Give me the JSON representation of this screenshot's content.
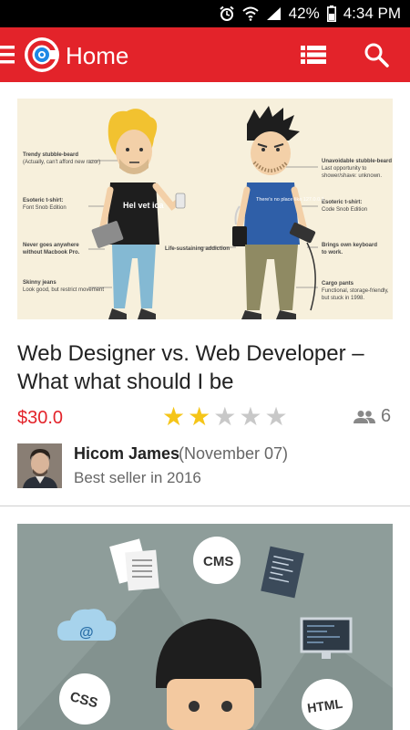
{
  "status_bar": {
    "battery_percent": "42%",
    "time": "4:34 PM",
    "icons": [
      "alarm-icon",
      "wifi-icon",
      "signal-icon",
      "battery-icon"
    ]
  },
  "app_bar": {
    "title": "Home",
    "color": "#e3232a",
    "icons": [
      "menu-icon",
      "app-logo-icon",
      "list-view-icon",
      "search-icon"
    ]
  },
  "posts": [
    {
      "illustration_labels": {
        "left_annotations": [
          "Trendy stubble-beard",
          "(Actually, can't afford new razor)",
          "Esoteric t-shirt:",
          "Font Snob Edition",
          "Never goes anywhere",
          "without Macbook Pro.",
          "Skinny jeans",
          "Look good, but restrict movement"
        ],
        "left_shirt": "Hel vet ica",
        "center_label": "Life-sustaining addiction",
        "right_shirt": "There's no place like 127.0.0.1",
        "right_annotations": [
          "Unavoidable stubble-beard",
          "Last opportunity to",
          "shower/shave: unknown.",
          "Esoteric t-shirt:",
          "Code Snob Edition",
          "Brings own keyboard",
          "to work.",
          "Cargo pants",
          "Functional, storage-friendly,",
          "but stuck in 1998."
        ]
      },
      "title": " Web Designer vs. Web Developer – What what should I be",
      "price": "$30.0",
      "rating": 2,
      "rating_max": 5,
      "participants": "6",
      "author": {
        "name": "Hicom James",
        "date": "(November 07)",
        "subtitle": "Best seller in 2016"
      }
    },
    {
      "illustration_labels": {
        "bubbles": [
          "CMS",
          "@",
          "CSS",
          "HTML"
        ]
      }
    }
  ]
}
